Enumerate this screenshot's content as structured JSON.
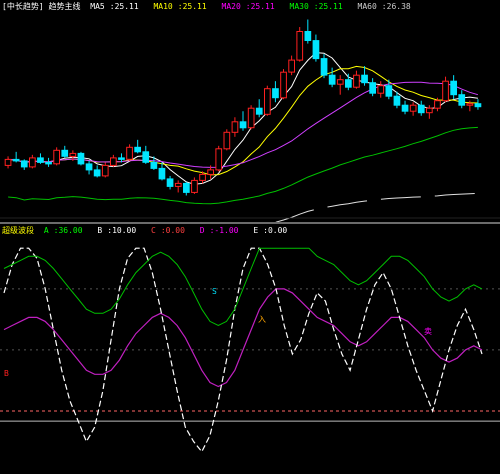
{
  "price_header": {
    "name": "[中长趋势] 趋势主线",
    "items": [
      {
        "label": "MA5",
        "value": "25.11",
        "color": "#ffffff"
      },
      {
        "label": "MA10",
        "value": "25.11",
        "color": "#ffff00"
      },
      {
        "label": "MA20",
        "value": "25.11",
        "color": "#ff00ff"
      },
      {
        "label": "MA30",
        "value": "25.11",
        "color": "#00ff00"
      },
      {
        "label": "MA60",
        "value": "26.38",
        "color": "#cccccc"
      }
    ]
  },
  "osc_header": {
    "name": "超级波段",
    "items": [
      {
        "label": "A",
        "value": "36.00",
        "color": "#00ff00"
      },
      {
        "label": "B",
        "value": "10.00",
        "color": "#ffffff"
      },
      {
        "label": "C",
        "value": "0.00",
        "color": "#ff4040"
      },
      {
        "label": "D",
        "value": "-1.00",
        "color": "#ff00ff"
      },
      {
        "label": "E",
        "value": "0.00",
        "color": "#ffffff"
      }
    ]
  },
  "osc_markers": {
    "buy": "B",
    "sell": "S",
    "entry": "入",
    "exit": "卖"
  },
  "colors": {
    "up": "#ff2020",
    "down": "#00e5ff",
    "ma_white": "#ffffff",
    "ma_yellow": "#ffff00",
    "ma_purple": "#d040ff",
    "ma_green": "#00c000",
    "ma_long": "#e0e0e0",
    "osc_white": "#ffffff",
    "osc_purple": "#c020c0",
    "osc_green": "#00c000"
  },
  "chart_data": [
    {
      "type": "candlestick",
      "candles": [
        [
          18.6,
          19.2,
          18.4,
          19.0
        ],
        [
          19.0,
          19.5,
          18.8,
          18.9
        ],
        [
          18.9,
          19.0,
          18.3,
          18.5
        ],
        [
          18.5,
          19.3,
          18.4,
          19.1
        ],
        [
          19.1,
          19.4,
          18.7,
          18.8
        ],
        [
          18.8,
          19.1,
          18.5,
          18.7
        ],
        [
          18.7,
          19.8,
          18.6,
          19.6
        ],
        [
          19.6,
          19.9,
          19.1,
          19.2
        ],
        [
          19.2,
          19.6,
          18.9,
          19.4
        ],
        [
          19.4,
          19.5,
          18.6,
          18.7
        ],
        [
          18.7,
          18.9,
          18.0,
          18.3
        ],
        [
          18.3,
          18.6,
          17.8,
          17.9
        ],
        [
          17.9,
          18.8,
          17.8,
          18.6
        ],
        [
          18.6,
          19.3,
          18.5,
          19.1
        ],
        [
          19.1,
          19.4,
          18.8,
          19.0
        ],
        [
          19.0,
          20.0,
          18.9,
          19.8
        ],
        [
          19.8,
          20.3,
          19.4,
          19.5
        ],
        [
          19.5,
          19.9,
          18.7,
          18.8
        ],
        [
          18.8,
          19.2,
          18.3,
          18.4
        ],
        [
          18.4,
          18.8,
          17.6,
          17.7
        ],
        [
          17.7,
          17.9,
          17.0,
          17.2
        ],
        [
          17.2,
          17.6,
          16.8,
          17.4
        ],
        [
          17.4,
          17.5,
          16.6,
          16.8
        ],
        [
          16.8,
          17.8,
          16.7,
          17.6
        ],
        [
          17.6,
          18.2,
          17.4,
          18.0
        ],
        [
          18.0,
          18.6,
          17.7,
          18.3
        ],
        [
          18.3,
          19.9,
          18.2,
          19.7
        ],
        [
          19.7,
          21.0,
          19.6,
          20.8
        ],
        [
          20.8,
          21.8,
          20.5,
          21.5
        ],
        [
          21.5,
          22.2,
          20.9,
          21.1
        ],
        [
          21.1,
          22.6,
          21.0,
          22.4
        ],
        [
          22.4,
          23.0,
          21.8,
          22.0
        ],
        [
          22.0,
          23.9,
          21.9,
          23.7
        ],
        [
          23.7,
          24.2,
          22.8,
          23.1
        ],
        [
          23.1,
          25.0,
          23.0,
          24.8
        ],
        [
          24.8,
          25.9,
          24.6,
          25.6
        ],
        [
          25.6,
          27.8,
          25.5,
          27.5
        ],
        [
          27.5,
          28.3,
          26.7,
          26.9
        ],
        [
          26.9,
          27.3,
          25.5,
          25.7
        ],
        [
          25.7,
          26.0,
          24.4,
          24.6
        ],
        [
          24.6,
          25.1,
          23.8,
          24.0
        ],
        [
          24.0,
          24.6,
          23.3,
          24.3
        ],
        [
          24.3,
          24.7,
          23.6,
          23.8
        ],
        [
          23.8,
          24.9,
          23.7,
          24.6
        ],
        [
          24.6,
          25.2,
          23.9,
          24.1
        ],
        [
          24.1,
          24.4,
          23.2,
          23.4
        ],
        [
          23.4,
          24.2,
          23.1,
          23.9
        ],
        [
          23.9,
          24.3,
          23.0,
          23.2
        ],
        [
          23.2,
          23.5,
          22.4,
          22.6
        ],
        [
          22.6,
          22.9,
          22.0,
          22.2
        ],
        [
          22.2,
          22.8,
          21.9,
          22.6
        ],
        [
          22.6,
          22.9,
          21.9,
          22.1
        ],
        [
          22.1,
          22.6,
          21.7,
          22.4
        ],
        [
          22.4,
          23.1,
          22.2,
          22.9
        ],
        [
          22.9,
          24.5,
          22.8,
          24.2
        ],
        [
          24.2,
          24.6,
          23.0,
          23.3
        ],
        [
          23.3,
          23.6,
          22.4,
          22.6
        ],
        [
          22.6,
          22.9,
          22.2,
          22.7
        ],
        [
          22.7,
          23.0,
          22.3,
          22.5
        ]
      ],
      "ymin": 15.5,
      "ymax": 28.8
    },
    {
      "type": "line",
      "series": [
        {
          "values": [
            78,
            92,
            100,
            100,
            95,
            80,
            60,
            40,
            25,
            15,
            5,
            12,
            30,
            55,
            80,
            95,
            100,
            100,
            88,
            70,
            50,
            30,
            12,
            5,
            0,
            8,
            25,
            45,
            70,
            90,
            100,
            100,
            92,
            80,
            62,
            48,
            55,
            68,
            78,
            74,
            60,
            48,
            40,
            55,
            70,
            82,
            88,
            80,
            66,
            52,
            40,
            30,
            20,
            35,
            50,
            62,
            70,
            60,
            48
          ]
        },
        {
          "values": [
            60,
            62,
            64,
            66,
            66,
            64,
            60,
            55,
            50,
            45,
            40,
            38,
            38,
            40,
            45,
            52,
            58,
            62,
            66,
            68,
            66,
            62,
            56,
            48,
            40,
            34,
            32,
            34,
            40,
            50,
            60,
            70,
            76,
            80,
            80,
            78,
            74,
            70,
            66,
            64,
            62,
            58,
            54,
            52,
            54,
            58,
            62,
            66,
            66,
            64,
            60,
            56,
            50,
            46,
            44,
            46,
            50,
            52,
            50
          ]
        }
      ],
      "ymin": -10,
      "ymax": 105
    }
  ]
}
